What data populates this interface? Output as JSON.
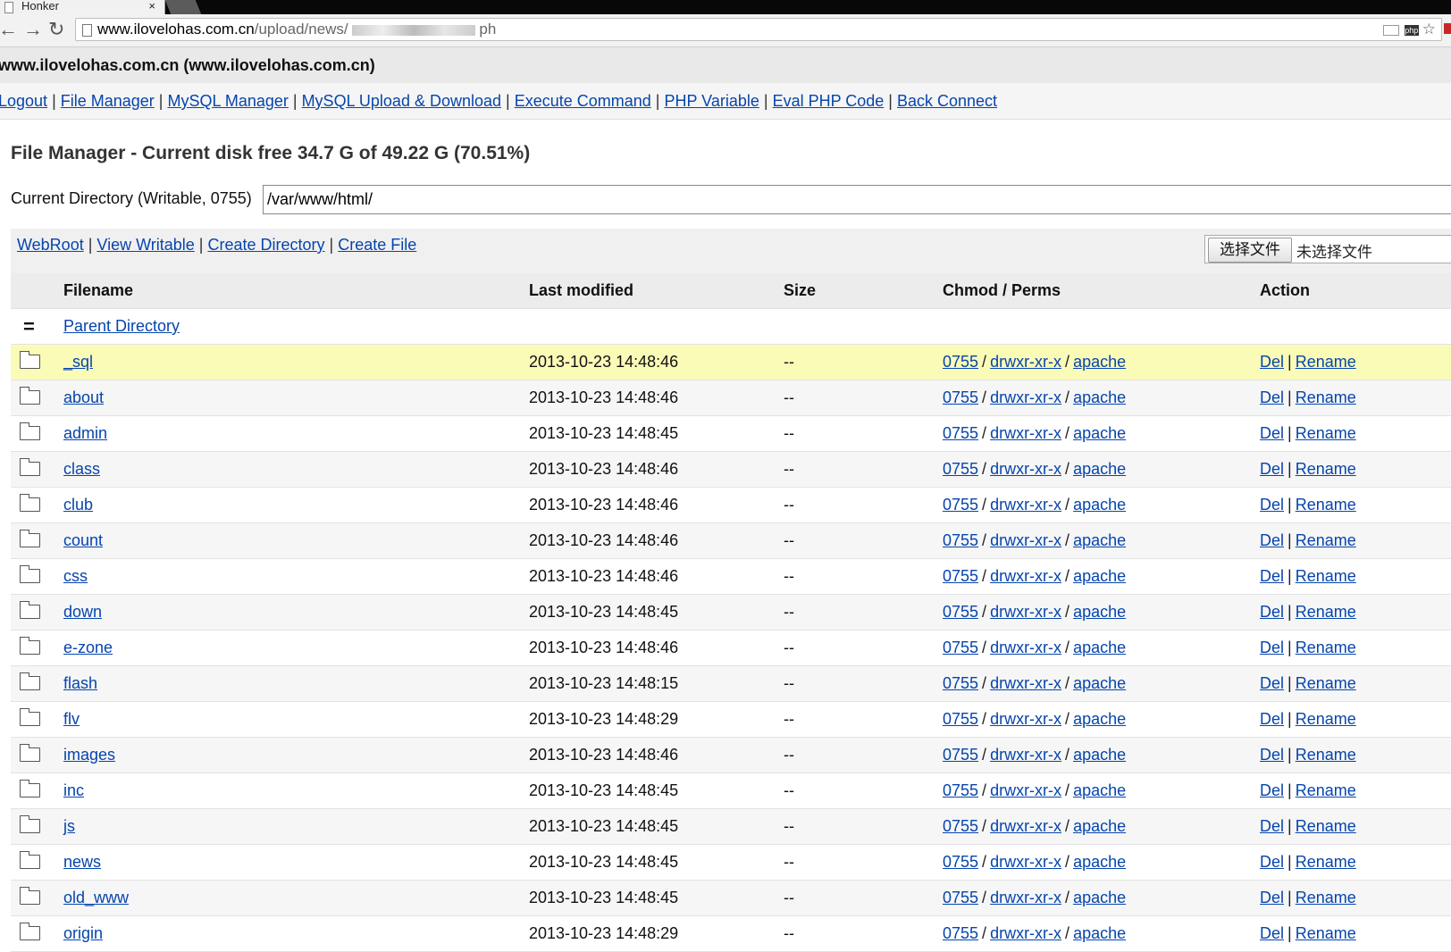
{
  "browser": {
    "tab_title": "Honker",
    "tab_close": "×",
    "back": "←",
    "forward": "→",
    "reload": "↻",
    "url_host": "www.ilovelohas.com.cn",
    "url_path": "/upload/news/",
    "url_trail": "ph",
    "ext_label": "php",
    "star": "☆"
  },
  "site": {
    "header": "www.ilovelohas.com.cn (www.ilovelohas.com.cn)",
    "nav": [
      "Logout",
      "File Manager",
      "MySQL Manager",
      "MySQL Upload & Download",
      "Execute Command",
      "PHP Variable",
      "Eval PHP Code",
      "Back Connect"
    ]
  },
  "file_manager": {
    "title": "File Manager - Current disk free 34.7 G of 49.22 G (70.51%)",
    "dir_label": "Current Directory (Writable, 0755)",
    "dir_value": "/var/www/html/",
    "actions": [
      "WebRoot",
      "View Writable",
      "Create Directory",
      "Create File"
    ],
    "upload": {
      "button": "选择文件",
      "status": "未选择文件"
    },
    "columns": {
      "filename": "Filename",
      "modified": "Last modified",
      "size": "Size",
      "perms": "Chmod / Perms",
      "action": "Action"
    },
    "parent": {
      "icon": "=",
      "label": "Parent Directory"
    },
    "row_labels": {
      "del": "Del",
      "rename": "Rename",
      "sep": "|",
      "slash": "/"
    },
    "rows": [
      {
        "name": "_sql",
        "modified": "2013-10-23 14:48:46",
        "size": "--",
        "chmod": "0755",
        "perms": "drwxr-xr-x",
        "owner": "apache"
      },
      {
        "name": "about",
        "modified": "2013-10-23 14:48:46",
        "size": "--",
        "chmod": "0755",
        "perms": "drwxr-xr-x",
        "owner": "apache"
      },
      {
        "name": "admin",
        "modified": "2013-10-23 14:48:45",
        "size": "--",
        "chmod": "0755",
        "perms": "drwxr-xr-x",
        "owner": "apache"
      },
      {
        "name": "class",
        "modified": "2013-10-23 14:48:46",
        "size": "--",
        "chmod": "0755",
        "perms": "drwxr-xr-x",
        "owner": "apache"
      },
      {
        "name": "club",
        "modified": "2013-10-23 14:48:46",
        "size": "--",
        "chmod": "0755",
        "perms": "drwxr-xr-x",
        "owner": "apache"
      },
      {
        "name": "count",
        "modified": "2013-10-23 14:48:46",
        "size": "--",
        "chmod": "0755",
        "perms": "drwxr-xr-x",
        "owner": "apache"
      },
      {
        "name": "css",
        "modified": "2013-10-23 14:48:46",
        "size": "--",
        "chmod": "0755",
        "perms": "drwxr-xr-x",
        "owner": "apache"
      },
      {
        "name": "down",
        "modified": "2013-10-23 14:48:45",
        "size": "--",
        "chmod": "0755",
        "perms": "drwxr-xr-x",
        "owner": "apache"
      },
      {
        "name": "e-zone",
        "modified": "2013-10-23 14:48:46",
        "size": "--",
        "chmod": "0755",
        "perms": "drwxr-xr-x",
        "owner": "apache"
      },
      {
        "name": "flash",
        "modified": "2013-10-23 14:48:15",
        "size": "--",
        "chmod": "0755",
        "perms": "drwxr-xr-x",
        "owner": "apache"
      },
      {
        "name": "flv",
        "modified": "2013-10-23 14:48:29",
        "size": "--",
        "chmod": "0755",
        "perms": "drwxr-xr-x",
        "owner": "apache"
      },
      {
        "name": "images",
        "modified": "2013-10-23 14:48:46",
        "size": "--",
        "chmod": "0755",
        "perms": "drwxr-xr-x",
        "owner": "apache"
      },
      {
        "name": "inc",
        "modified": "2013-10-23 14:48:45",
        "size": "--",
        "chmod": "0755",
        "perms": "drwxr-xr-x",
        "owner": "apache"
      },
      {
        "name": "js",
        "modified": "2013-10-23 14:48:45",
        "size": "--",
        "chmod": "0755",
        "perms": "drwxr-xr-x",
        "owner": "apache"
      },
      {
        "name": "news",
        "modified": "2013-10-23 14:48:45",
        "size": "--",
        "chmod": "0755",
        "perms": "drwxr-xr-x",
        "owner": "apache"
      },
      {
        "name": "old_www",
        "modified": "2013-10-23 14:48:45",
        "size": "--",
        "chmod": "0755",
        "perms": "drwxr-xr-x",
        "owner": "apache"
      },
      {
        "name": "origin",
        "modified": "2013-10-23 14:48:29",
        "size": "--",
        "chmod": "0755",
        "perms": "drwxr-xr-x",
        "owner": "apache"
      }
    ],
    "highlight_color": "#fbfbb8"
  }
}
